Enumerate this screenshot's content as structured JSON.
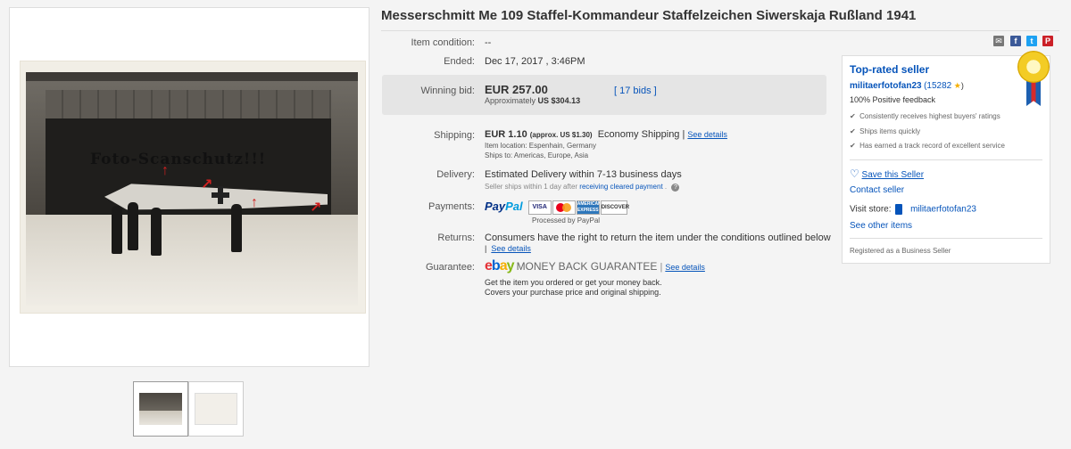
{
  "title": "Messerschmitt Me 109 Staffel-Kommandeur Staffelzeichen Siwerskaja Rußland 1941",
  "photo": {
    "watermark": "Foto-Scanschutz!!!"
  },
  "details": {
    "condition": {
      "label": "Item condition:",
      "value": "--"
    },
    "ended": {
      "label": "Ended:",
      "value": "Dec 17, 2017 , 3:46PM"
    },
    "winning_bid": {
      "label": "Winning bid:",
      "price": "EUR 257.00",
      "approx_prefix": "Approximately",
      "approx_value": "US $304.13",
      "bids": "[ 17 bids ]"
    },
    "shipping": {
      "label": "Shipping:",
      "price": "EUR 1.10",
      "approx": "(approx. US $1.30)",
      "method": "Economy Shipping |",
      "details_link": "See details",
      "location": "Item location:  Espenhain, Germany",
      "ships_to": "Ships to:  Americas, Europe, Asia"
    },
    "delivery": {
      "label": "Delivery:",
      "value": "Estimated Delivery within 7-13 business days",
      "note_prefix": "Seller ships within 1 day after",
      "note_link": "receiving cleared payment",
      "note_suffix": ".",
      "help": "?"
    },
    "payments": {
      "label": "Payments:",
      "paypal_a": "Pay",
      "paypal_b": "Pal",
      "cards": [
        "VISA",
        "",
        "AMERICAN EXPRESS",
        "DISCOVER"
      ],
      "processed": "Processed by PayPal"
    },
    "returns": {
      "label": "Returns:",
      "value": "Consumers have the right to return the item under the conditions outlined below",
      "details_link": "See details"
    },
    "guarantee": {
      "label": "Guarantee:",
      "logo": [
        "e",
        "b",
        "a",
        "y"
      ],
      "title": "MONEY BACK GUARANTEE",
      "details_link": "See details",
      "line1": "Get the item you ordered or get your money back.",
      "line2": "Covers your purchase price and original shipping."
    }
  },
  "share": [
    "✉",
    "f",
    "t",
    "P"
  ],
  "seller": {
    "heading": "Top-rated seller",
    "name": "militaerfotofan23",
    "score": "(15282",
    "score_end": ")",
    "feedback": "100% Positive feedback",
    "features": [
      "Consistently receives highest buyers' ratings",
      "Ships items quickly",
      "Has earned a track record of excellent service"
    ],
    "save": "Save this Seller",
    "contact": "Contact seller",
    "visit_label": "Visit store:",
    "store": "militaerfotofan23",
    "other_items": "See other items",
    "business": "Registered as a Business Seller"
  },
  "colors": {
    "link": "#0654ba",
    "price_box": "#e5e5e5",
    "accent_red": "#d12020"
  }
}
